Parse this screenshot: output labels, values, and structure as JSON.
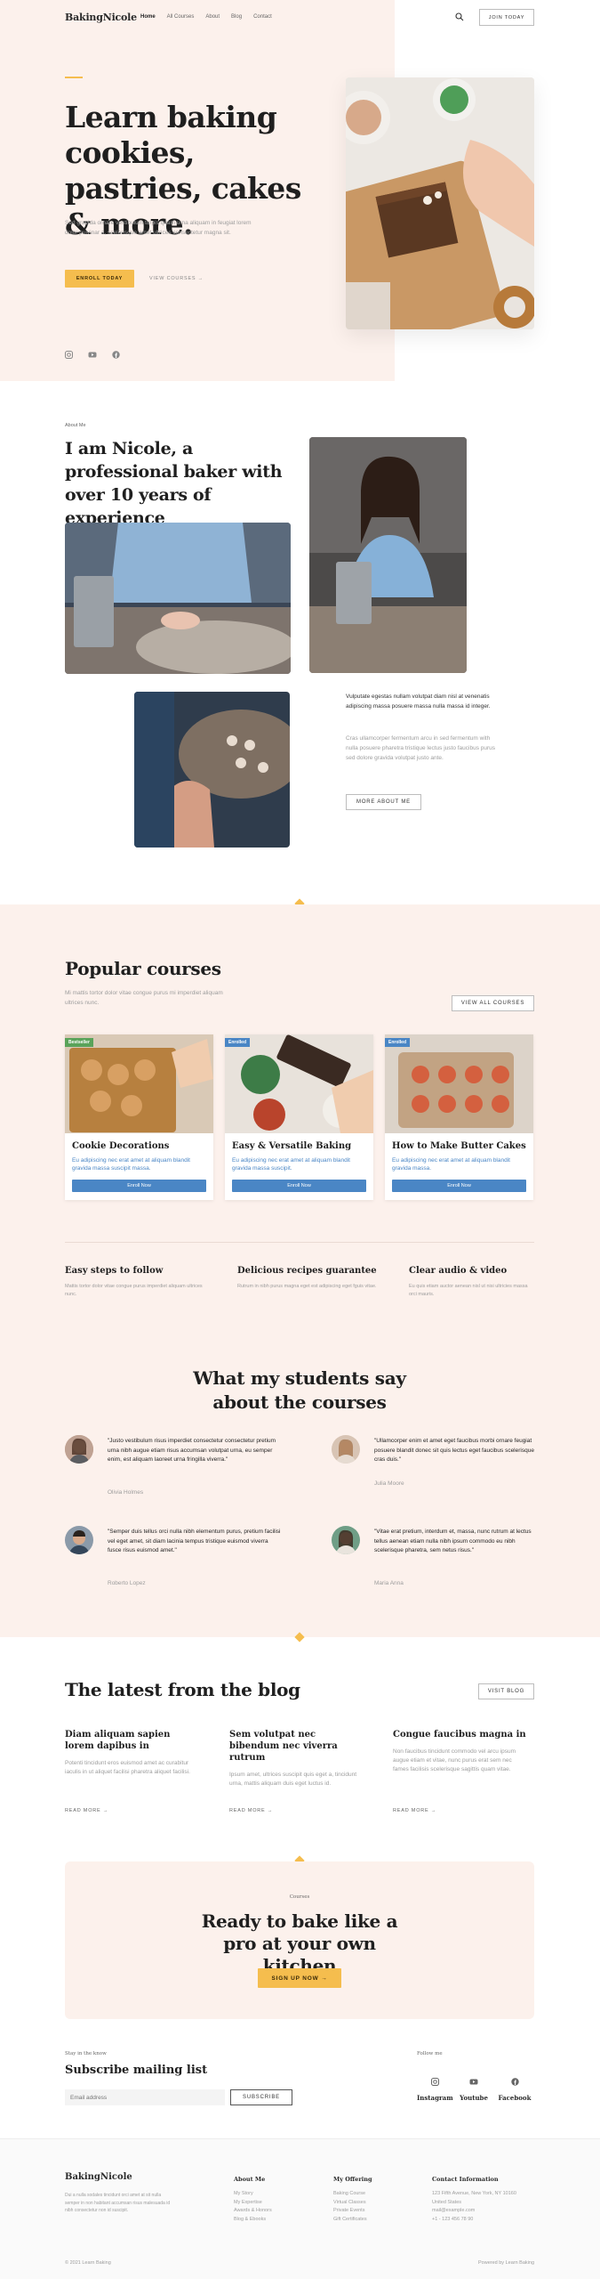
{
  "nav": {
    "brand": "BakingNicole",
    "items": [
      "Home",
      "All Courses",
      "About",
      "Blog",
      "Contact"
    ],
    "cta": "Join Today"
  },
  "hero": {
    "title": "Learn baking cookies, pastries, cakes & more.",
    "desc": "Sed gravida ornare vestibulum turpis quam urna aliquam in feugiat lorem dolor pulvinar a, scelerisque amet ultrices consectetur magna sit.",
    "enroll": "Enroll Today",
    "view": "View Courses →"
  },
  "about": {
    "eyebrow": "About Me",
    "title": "I am Nicole, a professional baker with over 10 years of experience",
    "p1": "Vulputate egestas nullam volutpat diam nisl at venenatis adipiscing massa posuere massa nulla massa id integer.",
    "p2": "Cras ullamcorper fermentum arcu in sed fermentum with nulla posuere pharetra tristique lectus justo faucibus purus sed dolore gravida volutpat justo ante.",
    "btn": "More About Me"
  },
  "courses": {
    "title": "Popular courses",
    "desc": "Mi mattis tortor dolor vitae congue purus mi imperdiet aliquam ultrices nunc.",
    "all": "View All Courses",
    "items": [
      {
        "badge": "Bestseller",
        "badge_color": "#5aa35a",
        "title": "Cookie Decorations",
        "desc": "Eu adipiscing nec erat amet at aliquam blandit gravida massa suscipit massa.",
        "btn": "Enroll Now"
      },
      {
        "badge": "Enrolled",
        "badge_color": "#4a86c5",
        "title": "Easy & Versatile Baking",
        "desc": "Eu adipiscing nec erat amet at aliquam blandit gravida massa suscipit.",
        "btn": "Enroll Now"
      },
      {
        "badge": "Enrolled",
        "badge_color": "#4a86c5",
        "title": "How to Make Butter Cakes",
        "desc": "Eu adipiscing nec erat amet at aliquam blandit gravida massa.",
        "btn": "Enroll Now"
      }
    ],
    "features": [
      {
        "title": "Easy steps to follow",
        "desc": "Mattis tortor dolor vitae congue purus imperdiet aliquam ultrices nunc."
      },
      {
        "title": "Delicious recipes guarantee",
        "desc": "Rutrum in nibh purus magna eget est adipiscing eget fguis vitae."
      },
      {
        "title": "Clear audio & video",
        "desc": "Eu quis etiam auctor aenean nisl ut nisi ultricies massa orci mauris."
      }
    ]
  },
  "testimonials": {
    "title": "What my students say about the courses",
    "items": [
      {
        "quote": "\"Justo vestibulum risus imperdiet consectetur consectetur pretium urna nibh augue etiam risus accumsan volutpat urna, eu semper enim, est aliquam laoreet urna fringilla viverra.\"",
        "name": "Olivia Holmes"
      },
      {
        "quote": "\"Ullamcorper enim et amet eget faucibus morbi ornare feugiat posuere blandit donec sit quis lectus eget faucibus scelerisque cras duis.\"",
        "name": "Julia Moore"
      },
      {
        "quote": "\"Semper duis tellus orci nulla nibh elementum purus, pretium facilisi vel eget amet, sit diam lacinia tempus tristique euismod viverra fusce risus euismod amet.\"",
        "name": "Roberto Lopez"
      },
      {
        "quote": "\"Vitae erat pretium, interdum et, massa, nunc rutrum at lectus tellus aenean etiam nulla nibh ipsum commodo eu nibh scelerisque pharetra, sem netus risus.\"",
        "name": "Maria Anna"
      }
    ]
  },
  "blog": {
    "title": "The latest from the blog",
    "visit": "Visit Blog",
    "posts": [
      {
        "title": "Diam aliquam sapien lorem dapibus in",
        "desc": "Potenti tincidunt eros euismod amet ac curabitur iaculis in ut aliquet facilisi pharetra aliquet facilisi.",
        "more": "Read More →"
      },
      {
        "title": "Sem volutpat nec bibendum nec viverra rutrum",
        "desc": "Ipsum amet, ultrices suscipit quis eget a, tincidunt urna, mattis aliquam duis eget luctus id.",
        "more": "Read More →"
      },
      {
        "title": "Congue faucibus magna in",
        "desc": "Non faucibus tincidunt commodo vel arcu ipsum augue etiam et vitae, nunc purus erat sem nec fames facilisis scelerisque sagittis quam vitae.",
        "more": "Read More →"
      }
    ]
  },
  "cta": {
    "eyebrow": "Courses",
    "title": "Ready to bake like a pro at your own kitchen",
    "btn": "Sign Up Now →"
  },
  "newsletter": {
    "eyebrow": "Stay in the know",
    "title": "Subscribe mailing list",
    "placeholder": "Email address",
    "btn": "Subscribe",
    "follow": "Follow me",
    "socials": [
      "Instagram",
      "Youtube",
      "Facebook"
    ]
  },
  "footer": {
    "brand": "BakingNicole",
    "desc": "Dui a nulla sodales tincidunt orci amet at sit nulla semper in non habitant accumsan risus malesuada id nibh consectetur non id suscipit.",
    "cols": [
      {
        "title": "About Me",
        "items": [
          "My Story",
          "My Expertise",
          "Awards & Honors",
          "Blog & Ebooks"
        ]
      },
      {
        "title": "My Offering",
        "items": [
          "Baking Course",
          "Virtual Classes",
          "Private Events",
          "Gift Certificates"
        ]
      },
      {
        "title": "Contact Information",
        "items": [
          "123 Fifth Avenue, New York, NY 10160",
          "United States",
          "mail@example.com",
          "+1 - 123 456 78 90"
        ]
      }
    ],
    "copyright": "© 2021 Learn Baking",
    "powered": "Powered by Learn Baking"
  }
}
